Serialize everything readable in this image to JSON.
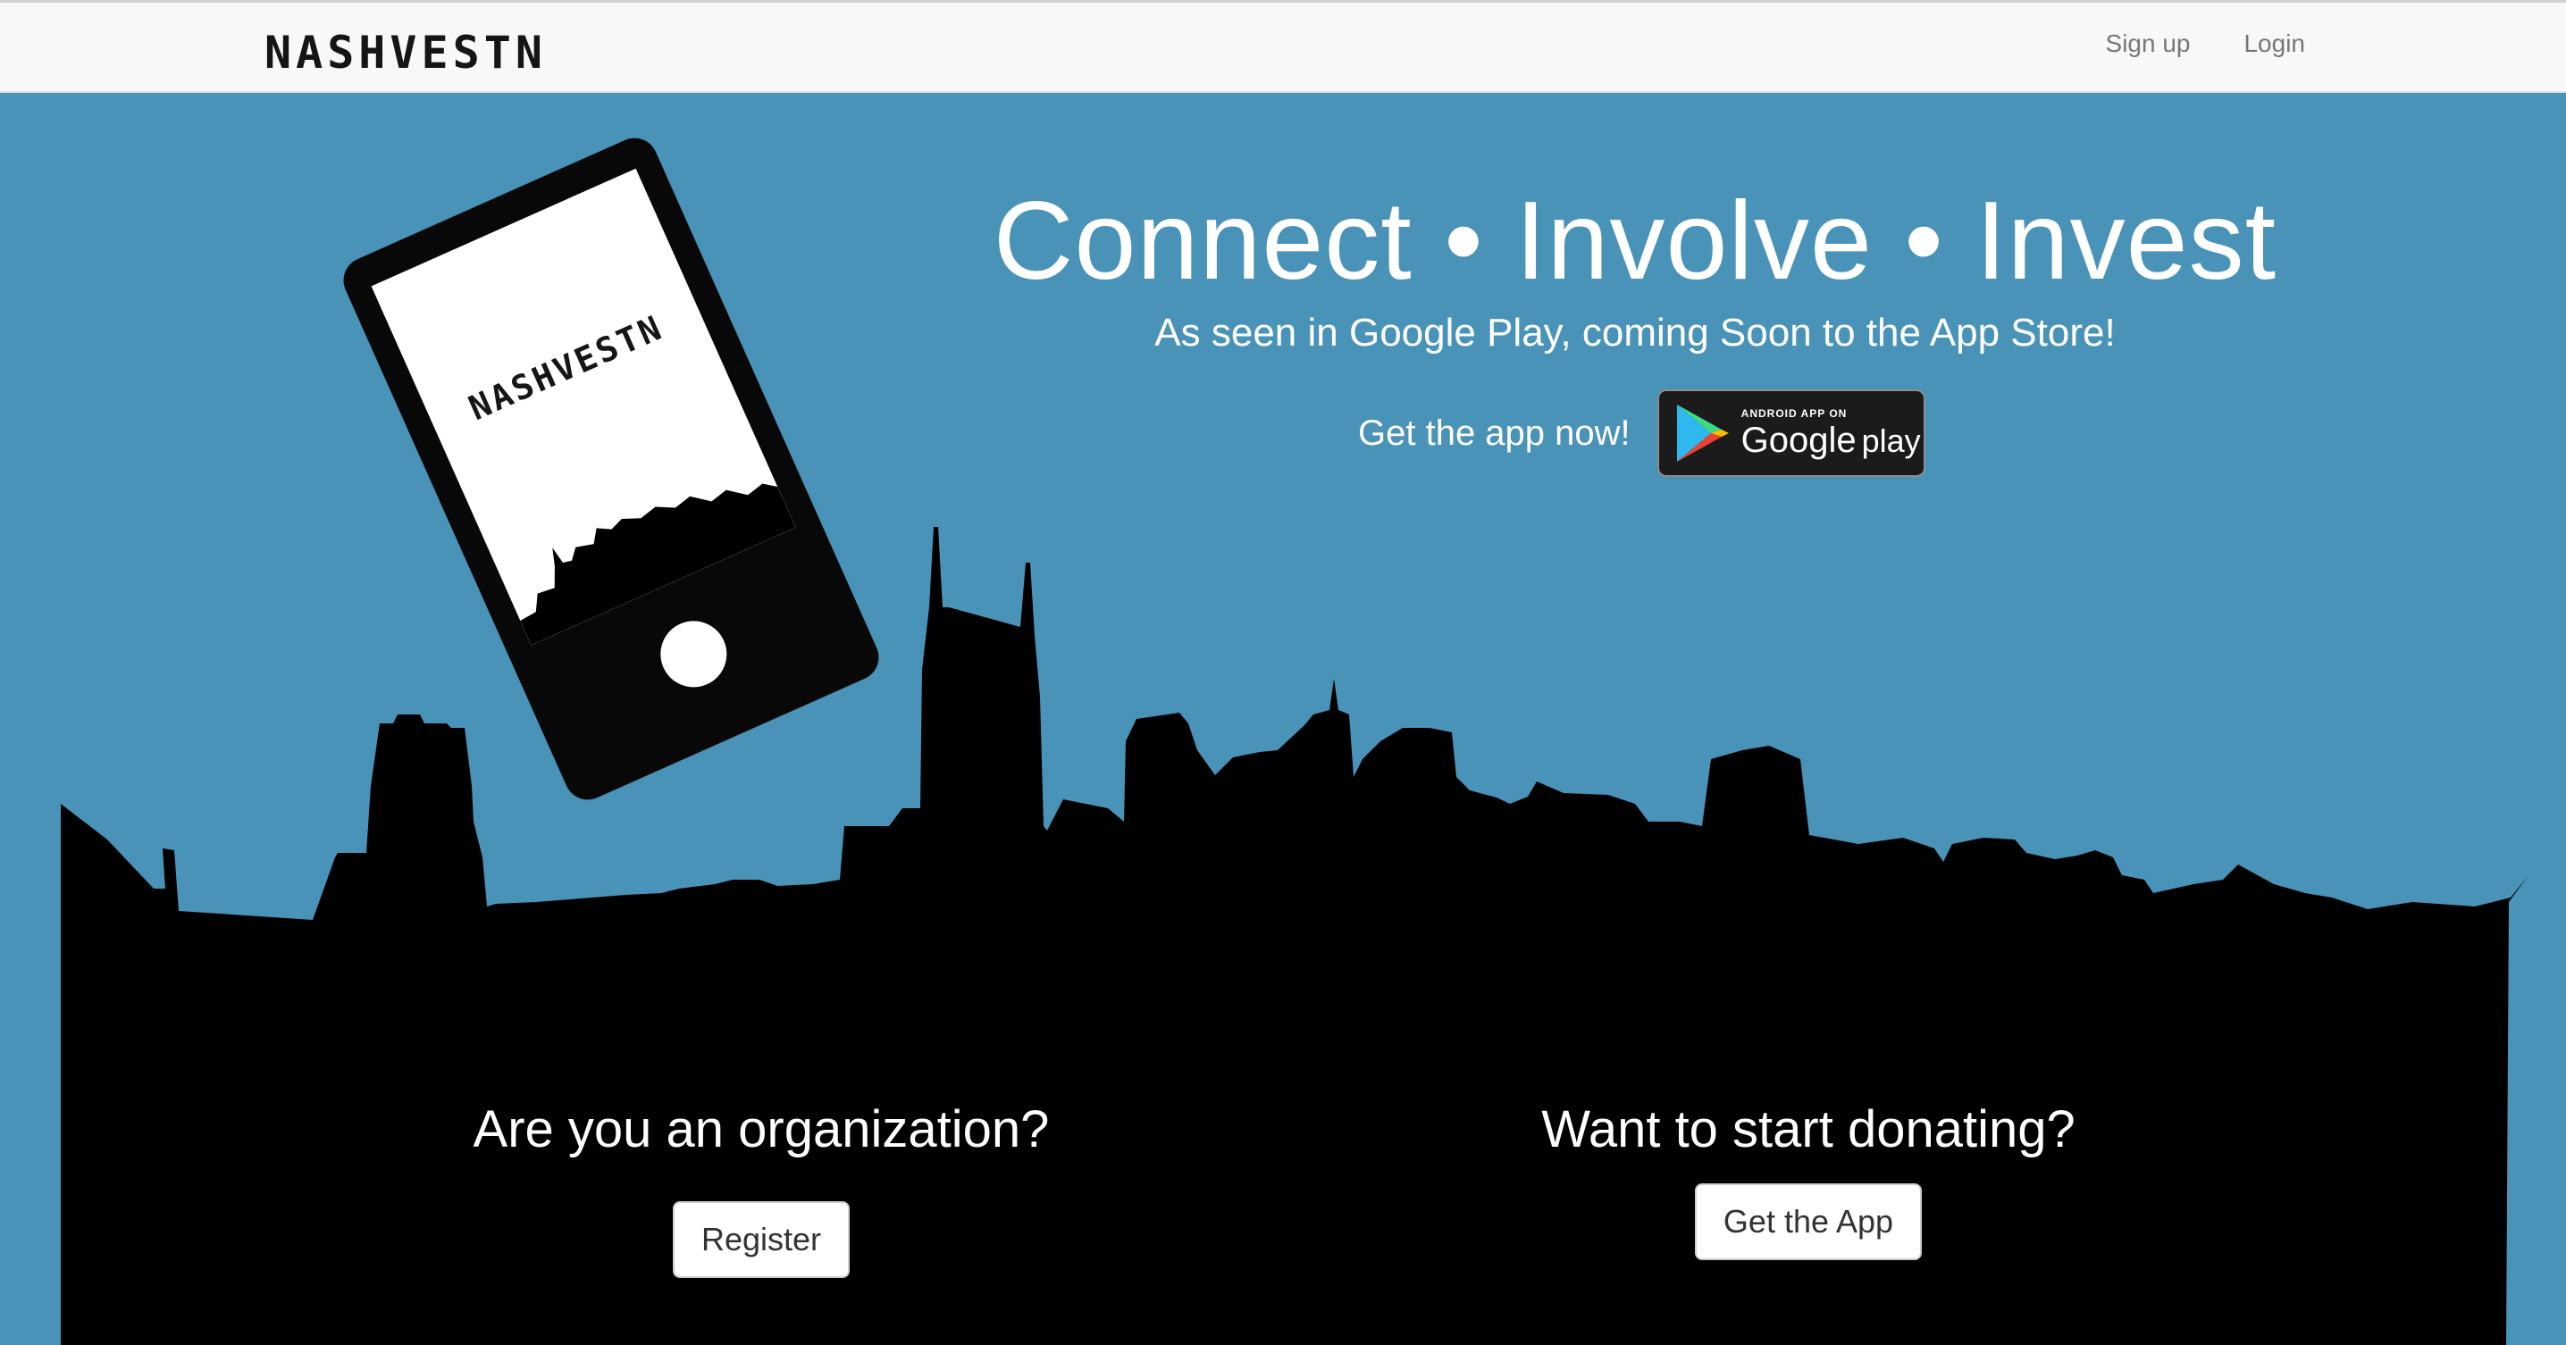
{
  "nav": {
    "brand": "NASHVESTN",
    "links": [
      {
        "label": "Sign up"
      },
      {
        "label": "Login"
      }
    ]
  },
  "hero": {
    "title": "Connect • Involve • Invest",
    "subtitle": "As seen in Google Play, coming Soon to the App Store!",
    "get_app_label": "Get the app now!",
    "badge": {
      "small_text": "ANDROID APP ON",
      "brand_text": "Google",
      "play_text": "play"
    }
  },
  "phone": {
    "screen_brand": "NASHVESTN"
  },
  "cta": {
    "organization": {
      "heading": "Are you an organization?",
      "button": "Register"
    },
    "donor": {
      "heading": "Want to start donating?",
      "button": "Get the App"
    }
  },
  "colors": {
    "background": "#4a93b8",
    "skyline": "#000000",
    "navbar": "#f8f8f8"
  },
  "icons": {
    "google_play": "google-play-icon"
  }
}
